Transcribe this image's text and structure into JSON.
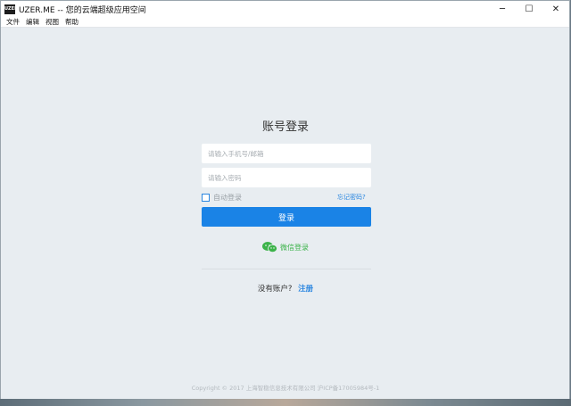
{
  "window": {
    "app_icon_text": "UZER",
    "title": "UZER.ME -- 您的云端超级应用空间",
    "controls": {
      "minimize": "─",
      "maximize": "☐",
      "close": "✕"
    }
  },
  "menubar": {
    "items": [
      "文件",
      "编辑",
      "视图",
      "帮助"
    ]
  },
  "login": {
    "title": "账号登录",
    "phone_placeholder": "请输入手机号/邮箱",
    "password_placeholder": "请输入密码",
    "auto_login_label": "自动登录",
    "forgot_label": "忘记密码?",
    "submit_label": "登录",
    "wechat_label": "微信登录",
    "no_account_text": "没有账户?",
    "signup_label": "注册"
  },
  "footer": {
    "copyright": "Copyright © 2017 上海智稳信息技术有限公司 沪ICP备17005984号-1"
  },
  "colors": {
    "accent": "#1a83e6",
    "wechat": "#3cb34a",
    "background": "#e8edf1"
  }
}
